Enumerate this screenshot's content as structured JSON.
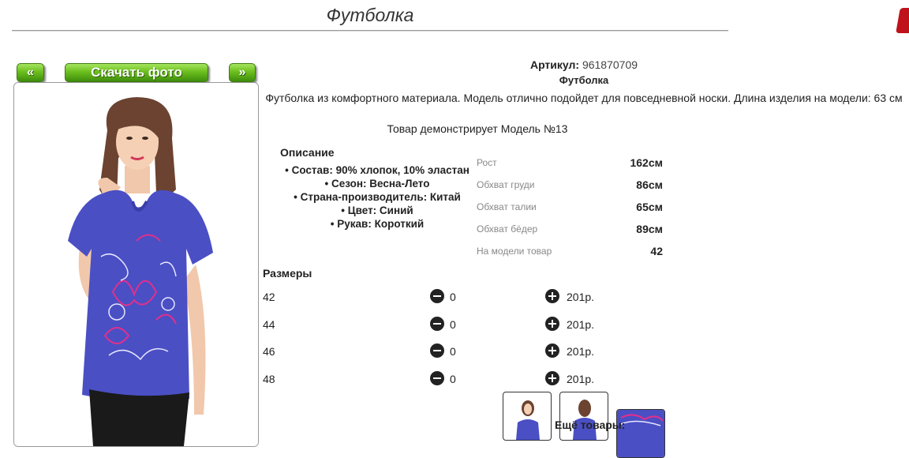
{
  "page": {
    "title": "Футболка"
  },
  "gallery": {
    "prev_label": "«",
    "download_label": "Скачать фото",
    "next_label": "»"
  },
  "product": {
    "sku_label": "Артикул:",
    "sku_value": "961870709",
    "name": "Футболка",
    "description": "Футболка из комфортного материала. Модель отлично подойдет для повседневной носки. Длина изделия на модели: 63 см",
    "model_note": "Товар демонстрирует Модель №13"
  },
  "specs": {
    "heading": "Описание",
    "items": [
      "Состав: 90% хлопок, 10% эластан",
      "Сезон: Весна-Лето",
      "Страна-производитель: Китай",
      "Цвет: Синий",
      "Рукав: Короткий"
    ]
  },
  "measurements": [
    {
      "label": "Рост",
      "value": "162см"
    },
    {
      "label": "Обхват груди",
      "value": "86см"
    },
    {
      "label": "Обхват талии",
      "value": "65см"
    },
    {
      "label": "Обхват бёдер",
      "value": "89см"
    },
    {
      "label": "На модели товар",
      "value": "42"
    }
  ],
  "sizes": {
    "heading": "Размеры",
    "rows": [
      {
        "size": "42",
        "qty": "0",
        "price": "201р."
      },
      {
        "size": "44",
        "qty": "0",
        "price": "201р."
      },
      {
        "size": "46",
        "qty": "0",
        "price": "201р."
      },
      {
        "size": "48",
        "qty": "0",
        "price": "201р."
      }
    ]
  },
  "more_products_label": "Ещё товары:",
  "colors": {
    "shirt": "#4a4fc4",
    "button_green": "#6cbf1e",
    "print_pink": "#e0308c"
  }
}
